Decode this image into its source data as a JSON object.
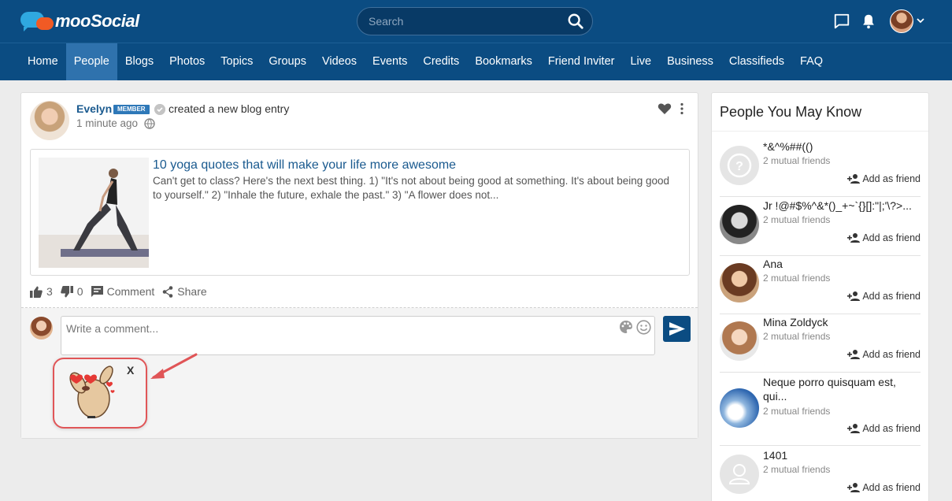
{
  "header": {
    "logo_text": "mooSocial",
    "search_placeholder": "Search"
  },
  "nav": {
    "items": [
      "Home",
      "People",
      "Blogs",
      "Photos",
      "Topics",
      "Groups",
      "Videos",
      "Events",
      "Credits",
      "Bookmarks",
      "Friend Inviter",
      "Live",
      "Business",
      "Classifieds",
      "FAQ"
    ],
    "active": "People"
  },
  "post": {
    "author": "Evelyn",
    "badge": "MEMBER",
    "action": "created a new blog entry",
    "time": "1 minute ago",
    "blog_title": "10 yoga quotes that will make your life more awesome",
    "blog_excerpt": "Can't get to class? Here's the next best thing. 1) \"It's not about being good at something. It's about being good to yourself.\" 2) \"Inhale the future, exhale the past.\" 3) \"A flower does not...",
    "likes": "3",
    "dislikes": "0",
    "comment_label": "Comment",
    "share_label": "Share",
    "comment_placeholder": "Write a comment...",
    "sticker_close": "X"
  },
  "sidebar": {
    "title": "People You May Know",
    "add_label": "Add as friend",
    "people": [
      {
        "name": "*&^%##(()",
        "mutual": "2 mutual friends"
      },
      {
        "name": "Jr !@#$%^&*()_+~`{}[]:\"|;'\\?>...",
        "mutual": "2 mutual friends"
      },
      {
        "name": "Ana",
        "mutual": "2 mutual friends"
      },
      {
        "name": "Mina Zoldyck",
        "mutual": "2 mutual friends"
      },
      {
        "name": "Neque porro quisquam est, qui...",
        "mutual": "2 mutual friends"
      },
      {
        "name": "1401",
        "mutual": "2 mutual friends"
      }
    ]
  },
  "colors": {
    "header_bg": "#0b4c82",
    "nav_active_bg": "#2f72ad",
    "link_blue": "#1a5a8f",
    "annotation_red": "#e05557"
  }
}
